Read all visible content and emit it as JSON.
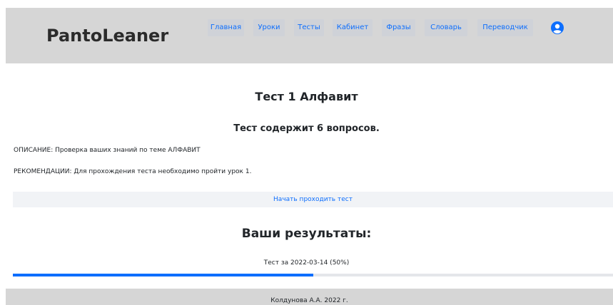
{
  "header": {
    "brand": "PantoLeaner",
    "nav": [
      "Главная",
      "Уроки",
      "Тесты",
      "Кабинет",
      "Фразы",
      "Словарь",
      "Переводчик"
    ],
    "user_icon": "user-icon"
  },
  "main": {
    "title": "Тест 1 Алфавит",
    "questions": "Тест содержит 6 вопросов.",
    "description": "ОПИСАНИЕ: Проверка ваших знаний по теме АЛФАВИТ",
    "recommendation": "РЕКОМЕНДАЦИИ: Для прохождения теста необходимо пройти урок 1.",
    "start_button": "Начать проходить тест",
    "results_heading": "Ваши результаты:",
    "result_entry": "Тест за 2022-03-14 (50%)",
    "result_progress": 0.5
  },
  "footer": {
    "text": "Колдунова А.А. 2022 г."
  },
  "colors": {
    "accent": "#0d6efd",
    "header_bg": "#d6d6d6"
  }
}
